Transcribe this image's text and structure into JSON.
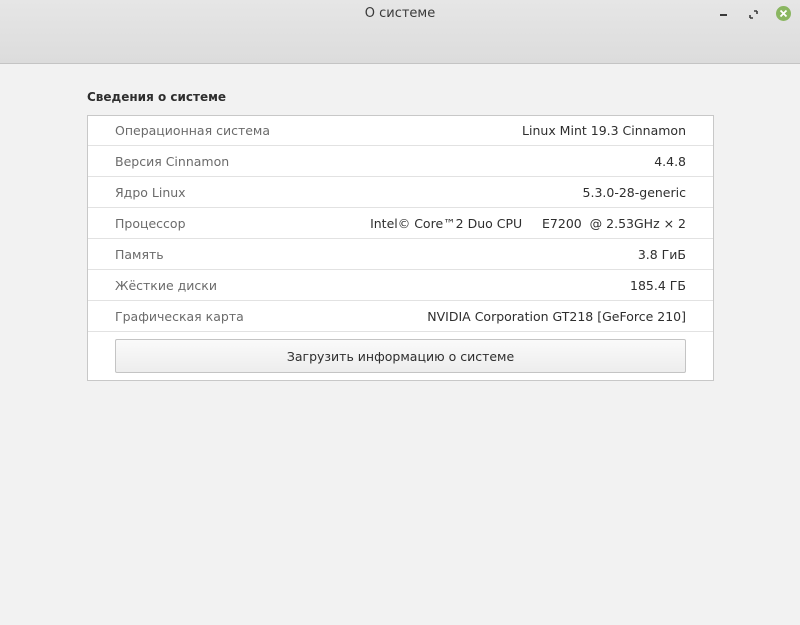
{
  "window": {
    "title": "О системе",
    "controls": {
      "minimize_icon": "minimize-icon",
      "maximize_icon": "maximize-icon",
      "close_icon": "close-icon",
      "close_color": "#8ab661"
    }
  },
  "section": {
    "title": "Сведения о системе"
  },
  "info_rows": [
    {
      "label": "Операционная система",
      "value": "Linux Mint 19.3 Cinnamon"
    },
    {
      "label": "Версия Cinnamon",
      "value": "4.4.8"
    },
    {
      "label": "Ядро Linux",
      "value": "5.3.0-28-generic"
    },
    {
      "label": "Процессор",
      "value": "Intel© Core™2 Duo CPU     E7200  @ 2.53GHz × 2"
    },
    {
      "label": "Память",
      "value": "3.8 ГиБ"
    },
    {
      "label": "Жёсткие диски",
      "value": "185.4 ГБ"
    },
    {
      "label": "Графическая карта",
      "value": "NVIDIA Corporation GT218 [GeForce 210]"
    }
  ],
  "upload_button": {
    "label": "Загрузить информацию о системе"
  }
}
